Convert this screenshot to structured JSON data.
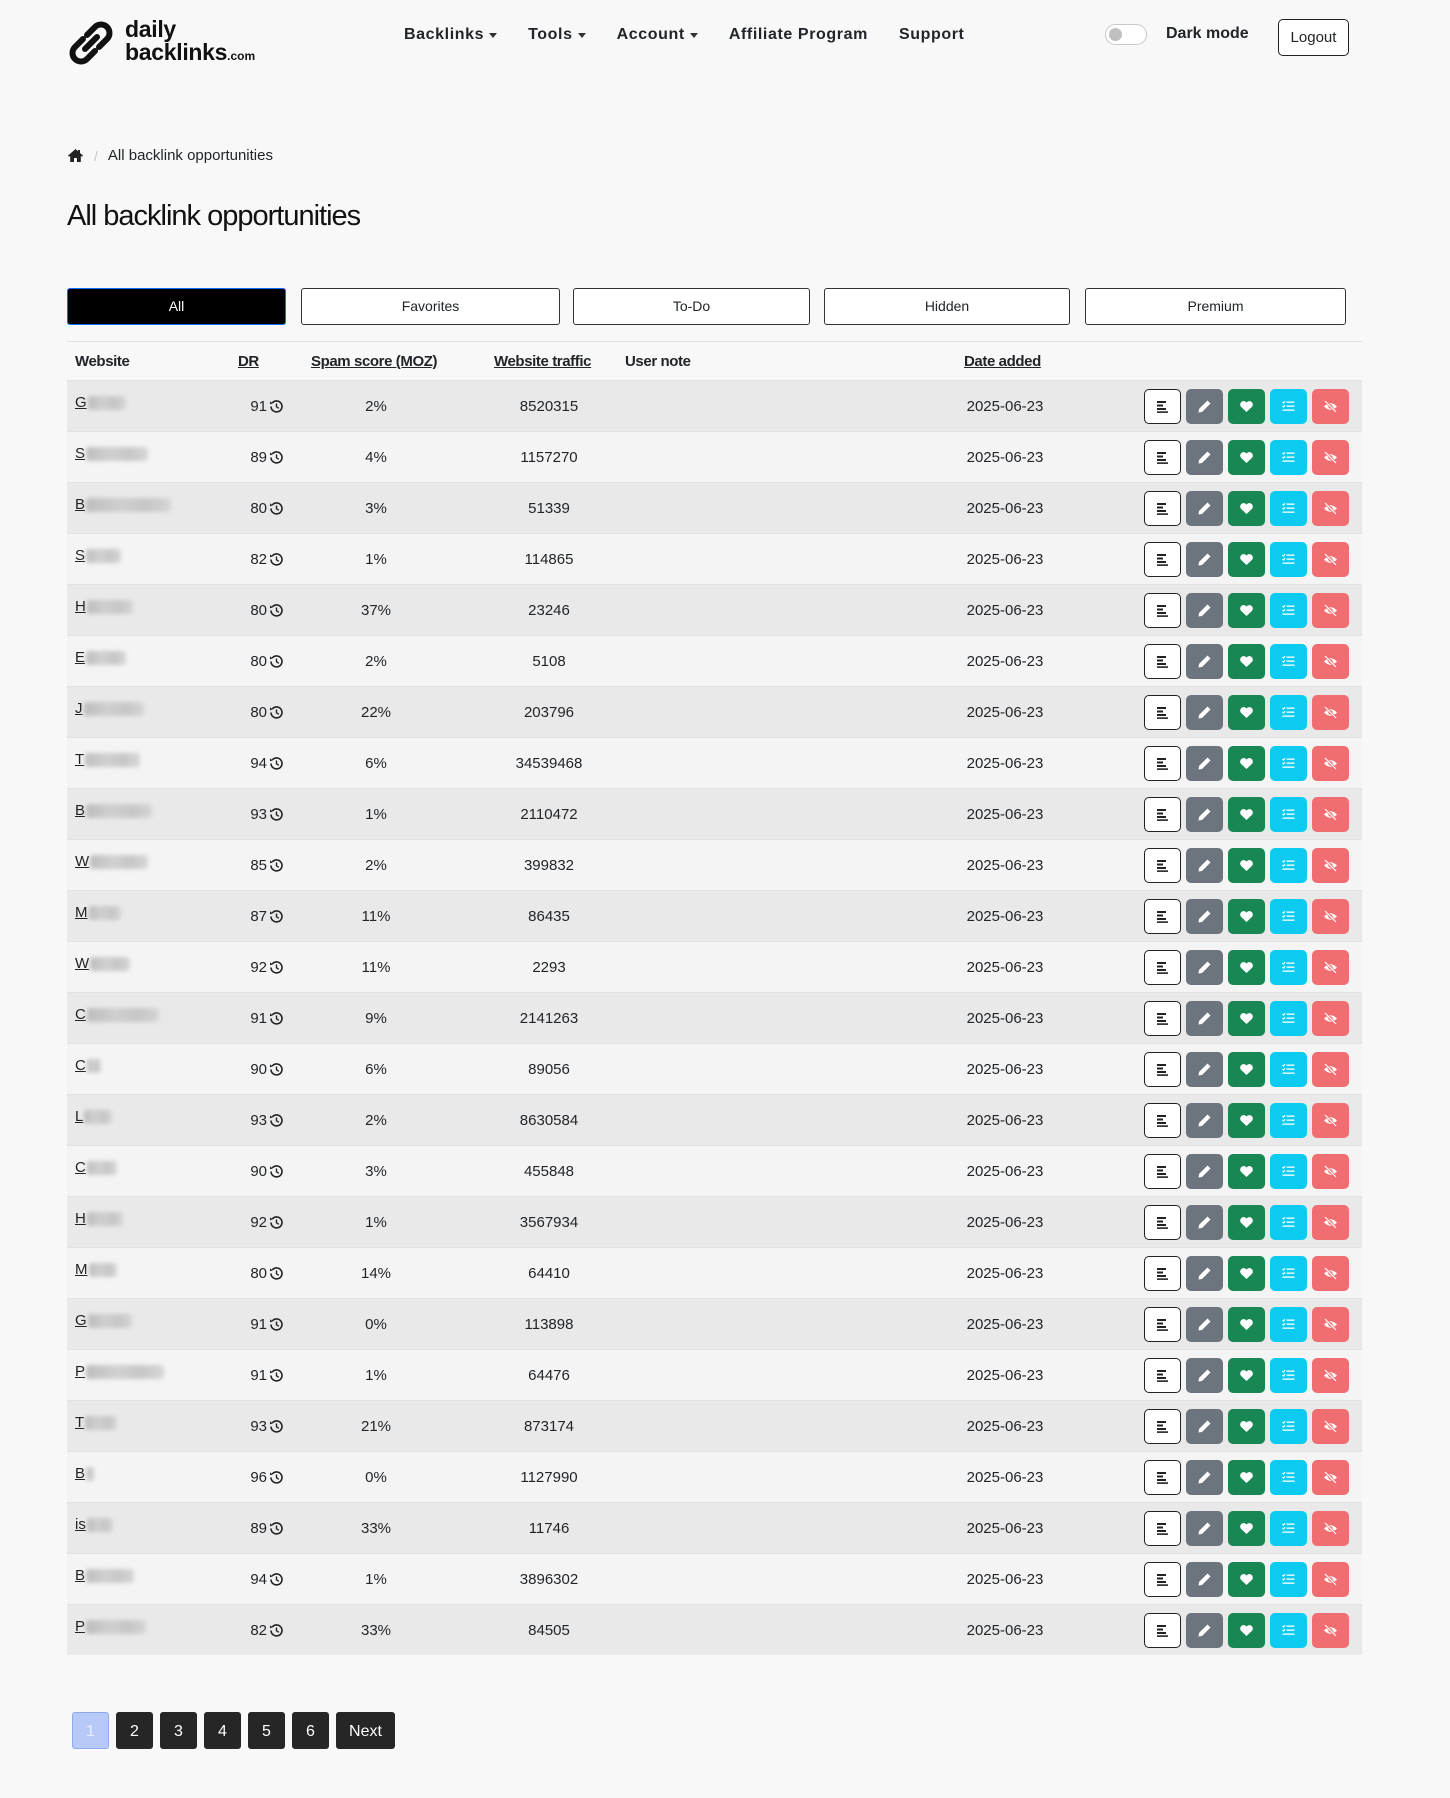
{
  "header": {
    "logo_line1": "daily",
    "logo_line2": "backlinks",
    "logo_suffix": ".com",
    "nav": [
      {
        "label": "Backlinks",
        "dropdown": true
      },
      {
        "label": "Tools",
        "dropdown": true
      },
      {
        "label": "Account",
        "dropdown": true
      },
      {
        "label": "Affiliate Program",
        "dropdown": false
      },
      {
        "label": "Support",
        "dropdown": false
      }
    ],
    "dark_mode_label": "Dark mode",
    "logout_label": "Logout"
  },
  "breadcrumb": {
    "current": "All backlink opportunities"
  },
  "page_title": "All backlink opportunities",
  "tabs": [
    {
      "label": "All",
      "active": true
    },
    {
      "label": "Favorites",
      "active": false
    },
    {
      "label": "To-Do",
      "active": false
    },
    {
      "label": "Hidden",
      "active": false
    },
    {
      "label": "Premium",
      "active": false
    }
  ],
  "table": {
    "columns": [
      "Website",
      "DR",
      "Spam score (MOZ)",
      "Website traffic",
      "User note",
      "Date added"
    ],
    "rows": [
      {
        "site_initial": "G",
        "blur_w": 38,
        "dr": "91",
        "spam": "2%",
        "traffic": "8520315",
        "note": "",
        "date": "2025-06-23"
      },
      {
        "site_initial": "S",
        "blur_w": 62,
        "dr": "89",
        "spam": "4%",
        "traffic": "1157270",
        "note": "",
        "date": "2025-06-23"
      },
      {
        "site_initial": "B",
        "blur_w": 85,
        "dr": "80",
        "spam": "3%",
        "traffic": "51339",
        "note": "",
        "date": "2025-06-23"
      },
      {
        "site_initial": "S",
        "blur_w": 35,
        "dr": "82",
        "spam": "1%",
        "traffic": "114865",
        "note": "",
        "date": "2025-06-23"
      },
      {
        "site_initial": "H",
        "blur_w": 46,
        "dr": "80",
        "spam": "37%",
        "traffic": "23246",
        "note": "",
        "date": "2025-06-23"
      },
      {
        "site_initial": "E",
        "blur_w": 40,
        "dr": "80",
        "spam": "2%",
        "traffic": "5108",
        "note": "",
        "date": "2025-06-23"
      },
      {
        "site_initial": "J",
        "blur_w": 60,
        "dr": "80",
        "spam": "22%",
        "traffic": "203796",
        "note": "",
        "date": "2025-06-23"
      },
      {
        "site_initial": "T",
        "blur_w": 55,
        "dr": "94",
        "spam": "6%",
        "traffic": "34539468",
        "note": "",
        "date": "2025-06-23"
      },
      {
        "site_initial": "B",
        "blur_w": 66,
        "dr": "93",
        "spam": "1%",
        "traffic": "2110472",
        "note": "",
        "date": "2025-06-23"
      },
      {
        "site_initial": "W",
        "blur_w": 58,
        "dr": "85",
        "spam": "2%",
        "traffic": "399832",
        "note": "",
        "date": "2025-06-23"
      },
      {
        "site_initial": "M",
        "blur_w": 32,
        "dr": "87",
        "spam": "11%",
        "traffic": "86435",
        "note": "",
        "date": "2025-06-23"
      },
      {
        "site_initial": "W",
        "blur_w": 40,
        "dr": "92",
        "spam": "11%",
        "traffic": "2293",
        "note": "",
        "date": "2025-06-23"
      },
      {
        "site_initial": "C",
        "blur_w": 72,
        "dr": "91",
        "spam": "9%",
        "traffic": "2141263",
        "note": "",
        "date": "2025-06-23"
      },
      {
        "site_initial": "C",
        "blur_w": 14,
        "dr": "90",
        "spam": "6%",
        "traffic": "89056",
        "note": "",
        "date": "2025-06-23"
      },
      {
        "site_initial": "L",
        "blur_w": 28,
        "dr": "93",
        "spam": "2%",
        "traffic": "8630584",
        "note": "",
        "date": "2025-06-23"
      },
      {
        "site_initial": "C",
        "blur_w": 30,
        "dr": "90",
        "spam": "3%",
        "traffic": "455848",
        "note": "",
        "date": "2025-06-23"
      },
      {
        "site_initial": "H",
        "blur_w": 36,
        "dr": "92",
        "spam": "1%",
        "traffic": "3567934",
        "note": "",
        "date": "2025-06-23"
      },
      {
        "site_initial": "M",
        "blur_w": 28,
        "dr": "80",
        "spam": "14%",
        "traffic": "64410",
        "note": "",
        "date": "2025-06-23"
      },
      {
        "site_initial": "G",
        "blur_w": 44,
        "dr": "91",
        "spam": "0%",
        "traffic": "113898",
        "note": "",
        "date": "2025-06-23"
      },
      {
        "site_initial": "P",
        "blur_w": 78,
        "dr": "91",
        "spam": "1%",
        "traffic": "64476",
        "note": "",
        "date": "2025-06-23"
      },
      {
        "site_initial": "T",
        "blur_w": 32,
        "dr": "93",
        "spam": "21%",
        "traffic": "873174",
        "note": "",
        "date": "2025-06-23"
      },
      {
        "site_initial": "B",
        "blur_w": 8,
        "dr": "96",
        "spam": "0%",
        "traffic": "1127990",
        "note": "",
        "date": "2025-06-23"
      },
      {
        "site_initial": "is",
        "blur_w": 26,
        "dr": "89",
        "spam": "33%",
        "traffic": "11746",
        "note": "",
        "date": "2025-06-23"
      },
      {
        "site_initial": "B",
        "blur_w": 48,
        "dr": "94",
        "spam": "1%",
        "traffic": "3896302",
        "note": "",
        "date": "2025-06-23"
      },
      {
        "site_initial": "P",
        "blur_w": 60,
        "dr": "82",
        "spam": "33%",
        "traffic": "84505",
        "note": "",
        "date": "2025-06-23"
      }
    ]
  },
  "pagination": {
    "pages": [
      "1",
      "2",
      "3",
      "4",
      "5",
      "6"
    ],
    "current": "1",
    "next_label": "Next"
  },
  "colors": {
    "detail": "#ffffff",
    "edit": "#6c757d",
    "favorite": "#198754",
    "todo": "#0dcaf0",
    "hide": "#f06e72",
    "active_tab": "#000000"
  },
  "icons": {
    "logo": "chain-link-icon",
    "home": "home-icon",
    "dr_history": "history-icon",
    "row_actions": [
      "details-lines-icon",
      "pencil-icon",
      "heart-icon",
      "list-check-icon",
      "eye-slash-icon"
    ]
  }
}
